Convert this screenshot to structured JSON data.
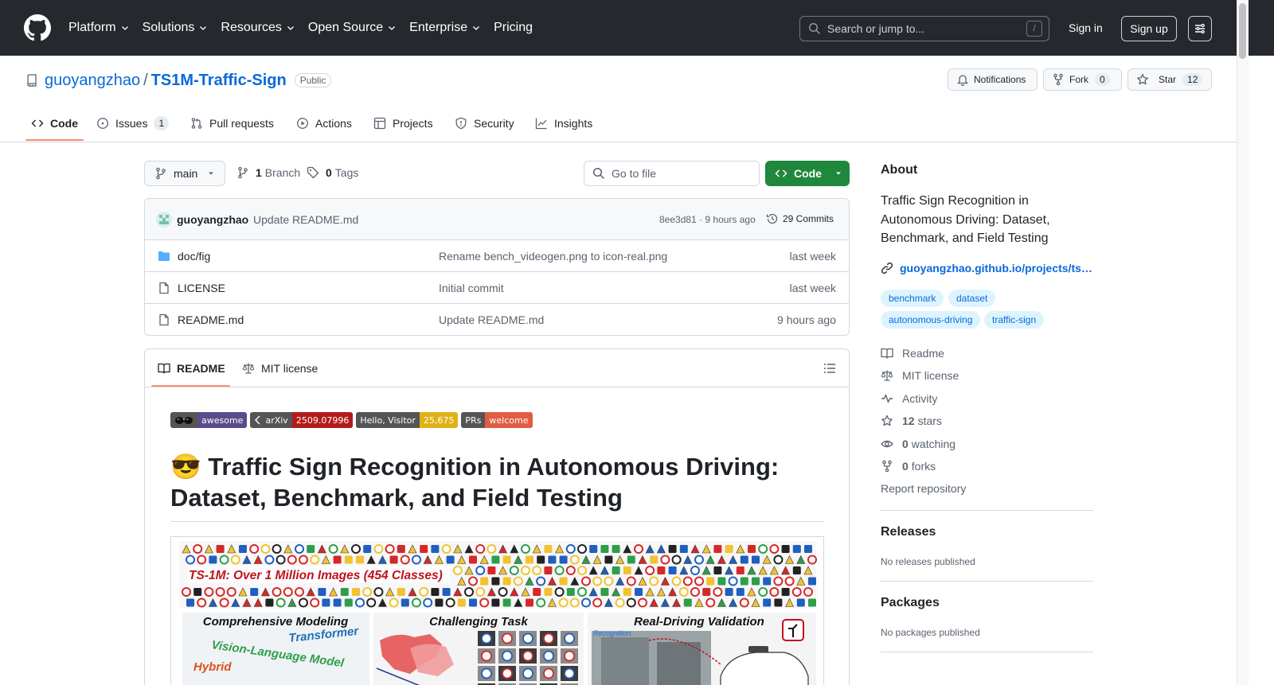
{
  "header": {
    "nav": [
      "Platform",
      "Solutions",
      "Resources",
      "Open Source",
      "Enterprise",
      "Pricing"
    ],
    "search_placeholder": "Search or jump to...",
    "search_shortcut": "/",
    "signin": "Sign in",
    "signup": "Sign up"
  },
  "repo": {
    "owner": "guoyangzhao",
    "separator": "/",
    "name": "TS1M-Traffic-Sign",
    "visibility": "Public",
    "notifications_label": "Notifications",
    "fork_label": "Fork",
    "fork_count": "0",
    "star_label": "Star",
    "star_count": "12"
  },
  "tabs": [
    {
      "label": "Code",
      "count": null
    },
    {
      "label": "Issues",
      "count": "1"
    },
    {
      "label": "Pull requests",
      "count": null
    },
    {
      "label": "Actions",
      "count": null
    },
    {
      "label": "Projects",
      "count": null
    },
    {
      "label": "Security",
      "count": null
    },
    {
      "label": "Insights",
      "count": null
    }
  ],
  "file_nav": {
    "branch": "main",
    "branch_count": "1",
    "branch_label": "Branch",
    "tag_count": "0",
    "tag_label": "Tags",
    "goto_placeholder": "Go to file",
    "code_button": "Code"
  },
  "latest_commit": {
    "author": "guoyangzhao",
    "message": "Update README.md",
    "meta": "8ee3d81 · 9 hours ago",
    "commits": "29 Commits"
  },
  "files": [
    {
      "name": "doc/fig",
      "type": "folder",
      "message": "Rename bench_videogen.png to icon-real.png",
      "time": "last week"
    },
    {
      "name": "LICENSE",
      "type": "file",
      "message": "Initial commit",
      "time": "last week"
    },
    {
      "name": "README.md",
      "type": "file",
      "message": "Update README.md",
      "time": "9 hours ago"
    }
  ],
  "readme": {
    "tab_readme": "README",
    "tab_license": "MIT license",
    "badges": [
      {
        "left": "",
        "right": "awesome",
        "left_color": "#555555",
        "right_color": "#5b4b8a"
      },
      {
        "left": "arXiv",
        "right": "2509.07996",
        "left_color": "#555555",
        "right_color": "#b31b1b"
      },
      {
        "left": "Hello, Visitor",
        "right": "25,675",
        "left_color": "#555555",
        "right_color": "#dfb317"
      },
      {
        "left": "PRs",
        "right": "welcome",
        "left_color": "#555555",
        "right_color": "#e05d44"
      }
    ],
    "title": "😎 Traffic Sign Recognition in Autonomous Driving: Dataset, Benchmark, and Field Testing",
    "teaser": {
      "banner": "TS-1M: Over 1 Million Images (454 Classes)",
      "panel1": "Comprehensive Modeling",
      "panel2": "Challenging Task",
      "panel3": "Real-Driving Validation",
      "label_transformer": "Transformer",
      "label_vlm": "Vision-Language Model",
      "label_hybrid": "Hybrid",
      "label_recognition": "Recognition"
    }
  },
  "sidebar": {
    "about_heading": "About",
    "description": "Traffic Sign Recognition in Autonomous Driving: Dataset, Benchmark, and Field Testing",
    "website": "guoyangzhao.github.io/projects/ts…",
    "topics": [
      "benchmark",
      "dataset",
      "autonomous-driving",
      "traffic-sign"
    ],
    "items": [
      {
        "icon": "book-icon",
        "bold": "",
        "label": "Readme"
      },
      {
        "icon": "law-icon",
        "bold": "",
        "label": "MIT license"
      },
      {
        "icon": "pulse-icon",
        "bold": "",
        "label": "Activity"
      },
      {
        "icon": "star-icon",
        "bold": "12",
        "label": "stars"
      },
      {
        "icon": "eye-icon",
        "bold": "0",
        "label": "watching"
      },
      {
        "icon": "fork-icon",
        "bold": "0",
        "label": "forks"
      }
    ],
    "report": "Report repository",
    "releases_heading": "Releases",
    "releases_text": "No releases published",
    "packages_heading": "Packages",
    "packages_text": "No packages published"
  },
  "colors": {
    "header_bg": "#25292e",
    "link": "#0969da",
    "primary_button": "#1f883d",
    "tab_underline": "#fd8c73"
  }
}
